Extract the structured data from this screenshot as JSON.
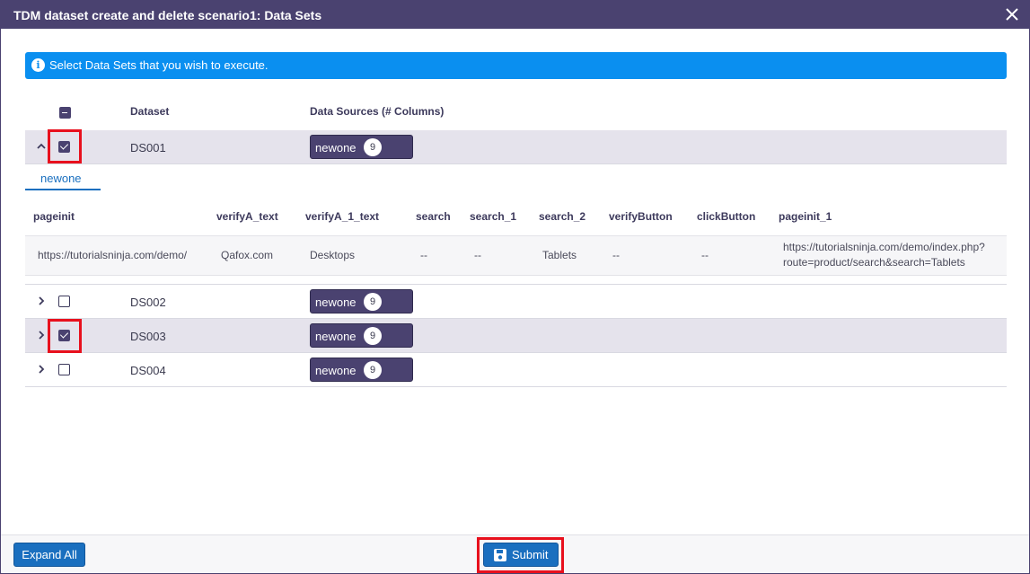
{
  "dialog": {
    "title": "TDM dataset create and delete scenario1: Data Sets",
    "close_icon": "close-icon"
  },
  "info": {
    "icon": "info-icon",
    "icon_glyph": "i",
    "message": "Select Data Sets that you wish to execute."
  },
  "table": {
    "headers": {
      "dataset": "Dataset",
      "sources": "Data Sources (# Columns)"
    },
    "select_all_state": "indeterminate",
    "rows": [
      {
        "name": "DS001",
        "checked": true,
        "expanded": true,
        "source": "newone",
        "columns": "9"
      },
      {
        "name": "DS002",
        "checked": false,
        "expanded": false,
        "source": "newone",
        "columns": "9"
      },
      {
        "name": "DS003",
        "checked": true,
        "expanded": false,
        "source": "newone",
        "columns": "9"
      },
      {
        "name": "DS004",
        "checked": false,
        "expanded": false,
        "source": "newone",
        "columns": "9"
      }
    ]
  },
  "detail": {
    "tab": "newone",
    "columns": [
      "pageinit",
      "verifyA_text",
      "verifyA_1_text",
      "search",
      "search_1",
      "search_2",
      "verifyButton",
      "clickButton",
      "pageinit_1"
    ],
    "values": [
      "https://tutorialsninja.com/demo/",
      "Qafox.com",
      "Desktops",
      "--",
      "--",
      "Tablets",
      "--",
      "--",
      "https://tutorialsninja.com/demo/index.php?\nroute=product/search&search=Tablets"
    ],
    "last_value_lines": [
      "https://tutorialsninja.com/demo/index.php?",
      "route=product/search&search=Tablets"
    ]
  },
  "footer": {
    "expand_all": "Expand All",
    "submit": "Submit",
    "submit_icon": "save-icon"
  },
  "colors": {
    "titlebar": "#4a4270",
    "info": "#0a8ff0",
    "button": "#1a6fbf",
    "highlight": "#e8101d",
    "selected_row": "#e5e3ec"
  }
}
